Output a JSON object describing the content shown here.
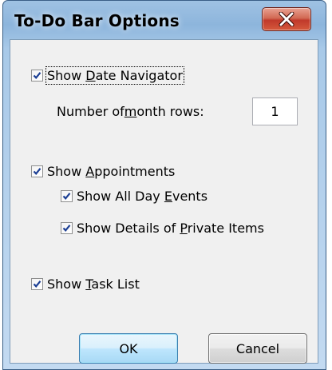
{
  "window": {
    "title": "To-Do Bar Options"
  },
  "options": {
    "show_date_navigator": {
      "label_pre": "Show ",
      "label_u": "D",
      "label_post": "ate Navigator",
      "checked": true
    },
    "month_rows": {
      "label_pre": "Number of ",
      "label_u": "m",
      "label_post": "onth rows:",
      "value": "1"
    },
    "show_appointments": {
      "label_pre": "Show ",
      "label_u": "A",
      "label_post": "ppointments",
      "checked": true
    },
    "show_all_day_events": {
      "label_pre": "Show All Day ",
      "label_u": "E",
      "label_post": "vents",
      "checked": true
    },
    "show_private_details": {
      "label_pre": "Show Details of ",
      "label_u": "P",
      "label_post": "rivate Items",
      "checked": true
    },
    "show_task_list": {
      "label_pre": "Show ",
      "label_u": "T",
      "label_post": "ask List",
      "checked": true
    }
  },
  "buttons": {
    "ok_label": "OK",
    "cancel_label": "Cancel"
  },
  "colors": {
    "title_bar": "#8db5dc",
    "close_button": "#c0392b",
    "client_background": "#f0f0f0",
    "check_mark": "#1c3f94",
    "default_button_border": "#3c7fb1"
  },
  "icons": {
    "close": "close-x-icon",
    "check": "checkmark-icon"
  }
}
